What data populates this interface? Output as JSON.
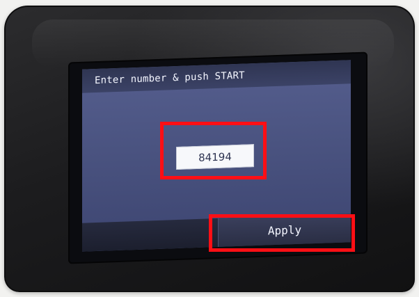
{
  "screen": {
    "title": "Enter number & push START",
    "number_value": "84194",
    "apply_label": "Apply"
  },
  "colors": {
    "screen_background": "#4a5380",
    "title_bar": "#2f3552",
    "highlight": "#ff0f15"
  }
}
